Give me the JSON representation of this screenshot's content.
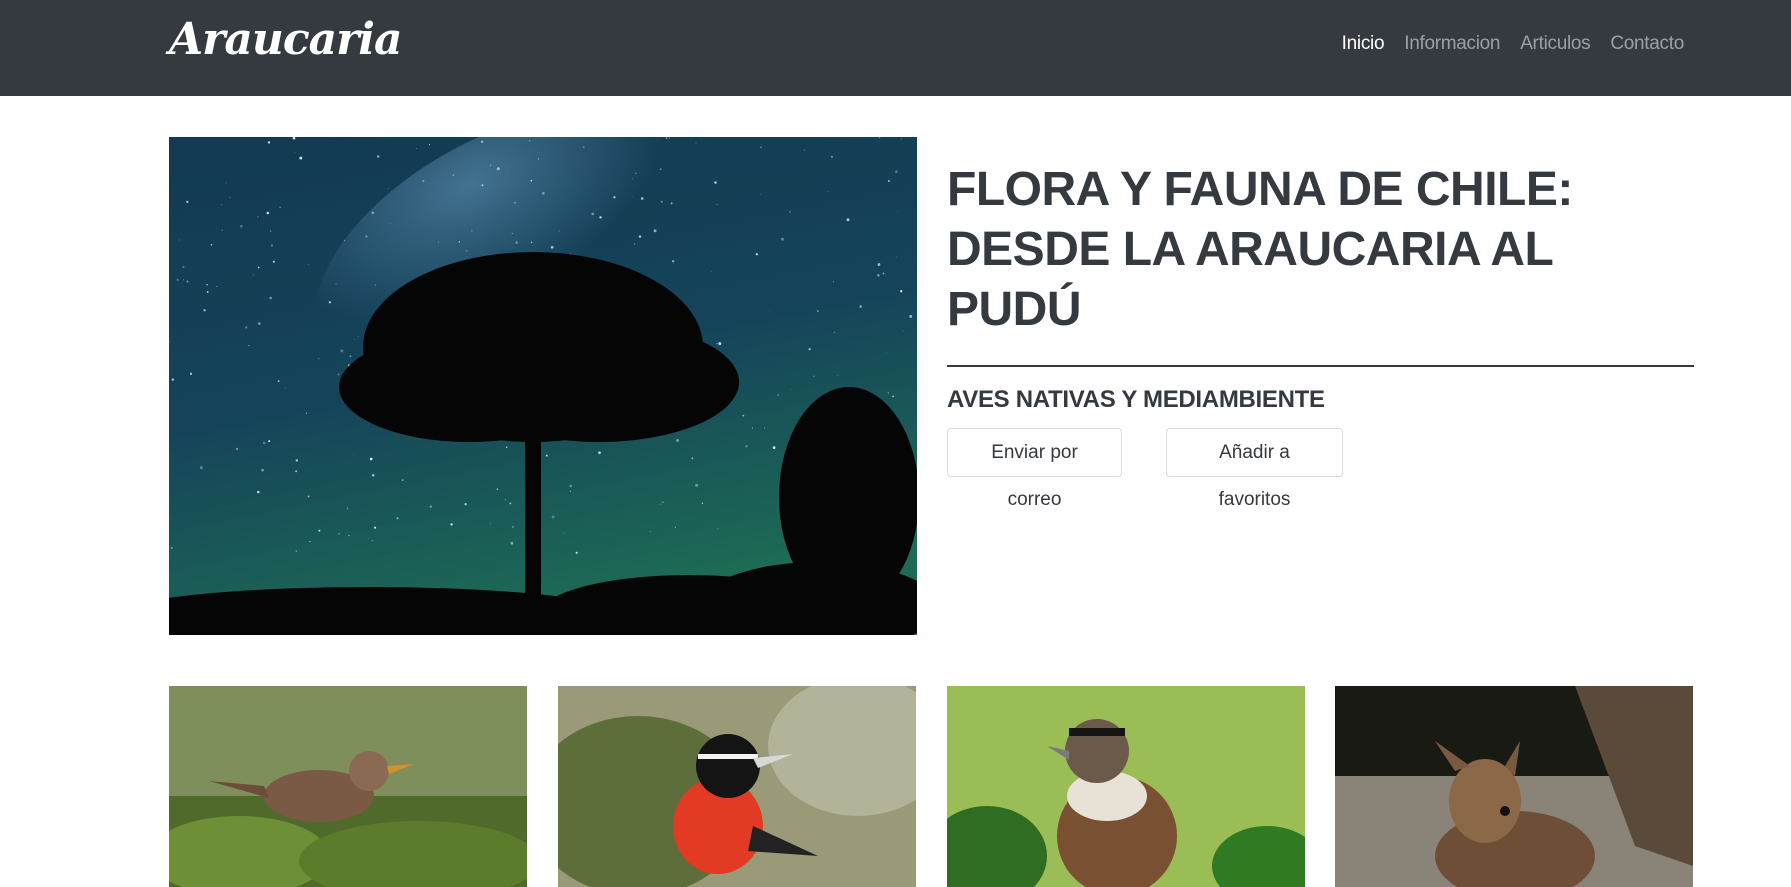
{
  "brand": {
    "name": "Araucaria"
  },
  "nav": {
    "items": [
      {
        "label": "Inicio",
        "active": true
      },
      {
        "label": "Informacion",
        "active": false
      },
      {
        "label": "Articulos",
        "active": false
      },
      {
        "label": "Contacto",
        "active": false
      }
    ]
  },
  "hero": {
    "title": "FLORA Y FAUNA DE CHILE: DESDE LA ARAUCARIA AL PUDÚ",
    "subtitle": "AVES NATIVAS Y MEDIAMBIENTE",
    "buttons": {
      "email": "Enviar por correo",
      "favorites": "Añadir a favoritos"
    },
    "image": "araucaria-night-sky"
  },
  "cards": [
    {
      "image": "chilean-wren-bird"
    },
    {
      "image": "long-tailed-meadowlark-bird"
    },
    {
      "image": "rufous-collared-sparrow-bird"
    },
    {
      "image": "pudu-deer"
    }
  ],
  "colors": {
    "navbar": "#343a40",
    "nav_active": "#ffffff",
    "nav_inactive": "#9aa0a6",
    "text": "#343a40"
  }
}
